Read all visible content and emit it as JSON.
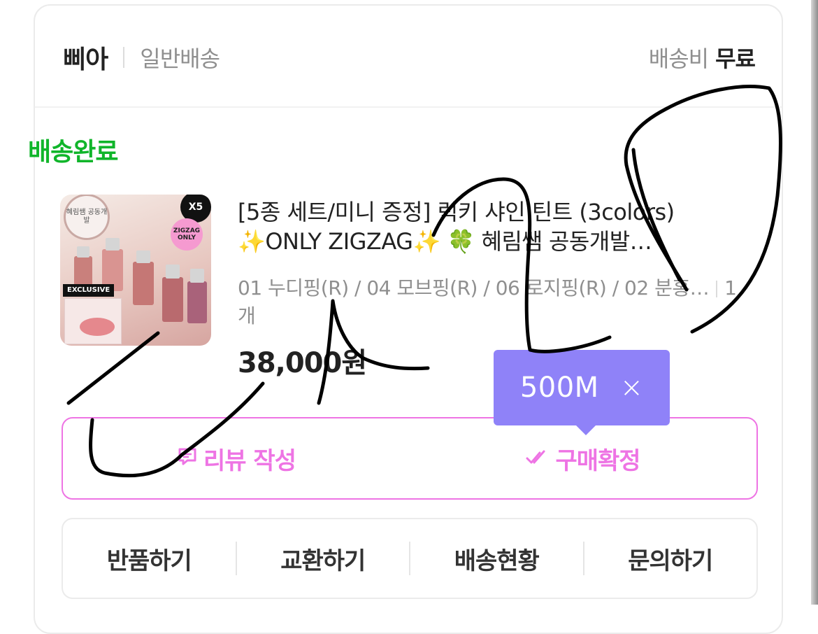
{
  "header": {
    "seller": "삐아",
    "shipping_type": "일반배송",
    "fee_label": "배송비",
    "fee_value": "무료"
  },
  "order": {
    "status": "배송완료",
    "status_color": "#10b52a"
  },
  "product": {
    "title_line1": "[5종 세트/미니 증정] 럭키 샤인 틴트 (3colors)",
    "title_line2": "✨ONLY ZIGZAG✨ 🍀 혜림쌤 공동개발…",
    "option": "01 누디핑(R) / 04 모브핑(R) / 06 로지핑(R) / 02 분홍…",
    "quantity": "1개",
    "price": "38,000원",
    "thumbnail": {
      "badge_text": "혜림쌤 공동개발",
      "count_badge": "X5",
      "zigzag_badge": "ZIGZAG ONLY",
      "exclusive_label": "EXCLUSIVE"
    }
  },
  "tooltip": {
    "text": "500M",
    "close_icon": "×",
    "color": "#8f82f8"
  },
  "actions": {
    "review_icon": "review-note-icon",
    "review": "리뷰 작성",
    "confirm_icon": "double-check-icon",
    "confirm": "구매확정",
    "accent": "#ee74e4"
  },
  "buttons": {
    "return": "반품하기",
    "exchange": "교환하기",
    "tracking": "배송현황",
    "inquiry": "문의하기"
  }
}
